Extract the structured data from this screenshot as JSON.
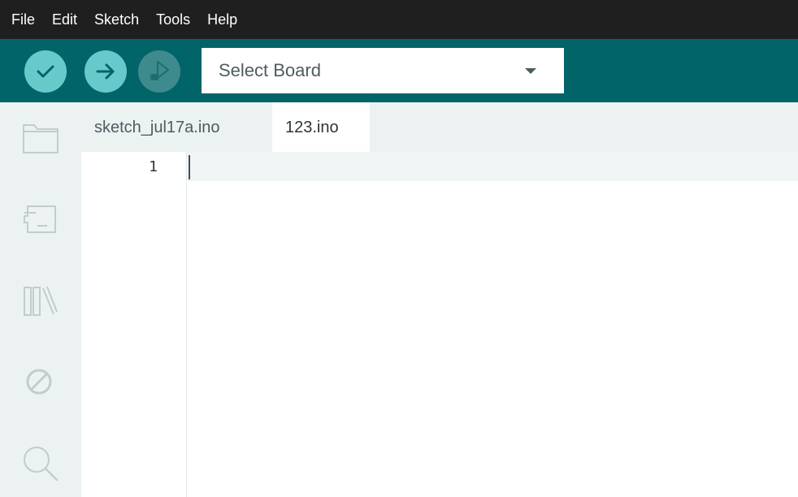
{
  "menu": {
    "items": [
      {
        "label": "File"
      },
      {
        "label": "Edit"
      },
      {
        "label": "Sketch"
      },
      {
        "label": "Tools"
      },
      {
        "label": "Help"
      }
    ]
  },
  "toolbar": {
    "buttons": [
      {
        "icon": "checkmark-icon",
        "action": "verify"
      },
      {
        "icon": "arrow-right-icon",
        "action": "upload"
      },
      {
        "icon": "debug-icon",
        "action": "debug",
        "disabled": true
      }
    ],
    "board_select": {
      "value": "Select Board"
    }
  },
  "sidebar": {
    "icons": [
      "folder-icon",
      "board-icon",
      "library-icon",
      "blocked-icon",
      "search-icon"
    ]
  },
  "tabs": [
    {
      "label": "sketch_jul17a.ino",
      "active": false
    },
    {
      "label": "123.ino",
      "active": true
    }
  ],
  "editor": {
    "line_numbers": [
      "1"
    ]
  },
  "colors": {
    "menubar": "#1f1f1f",
    "toolbar": "#006468",
    "button": "#67c9c9",
    "sidebar": "#ecf1f1",
    "text": "#4e5b61"
  }
}
